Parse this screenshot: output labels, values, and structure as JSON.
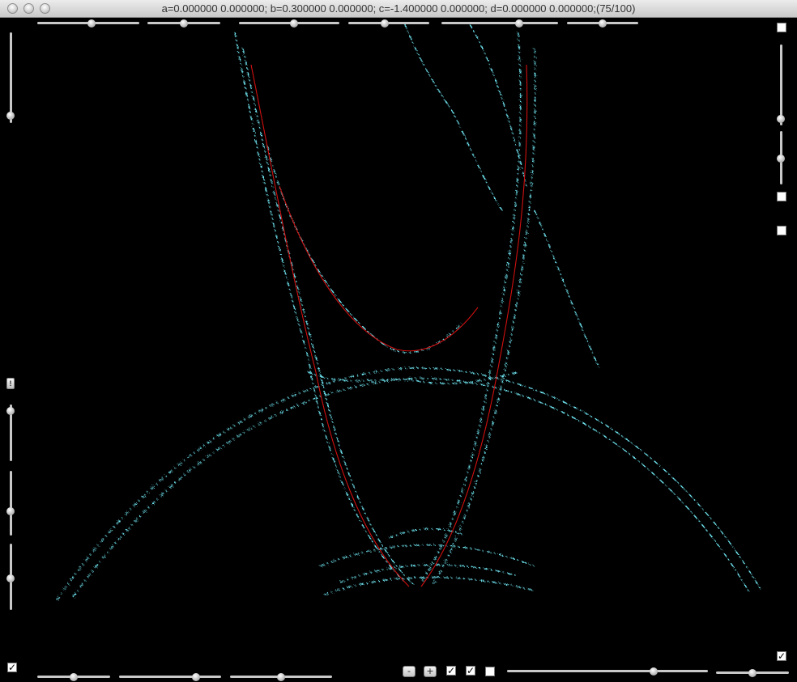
{
  "window": {
    "title": "a=0.000000 0.000000; b=0.300000 0.000000; c=-1.400000 0.000000; d=0.000000 0.000000;(75/100)"
  },
  "controls": {
    "top_sliders": [
      {
        "name": "top-slider-1",
        "value": 0.53
      },
      {
        "name": "top-slider-2",
        "value": 0.5
      },
      {
        "name": "top-slider-3",
        "value": 0.55
      },
      {
        "name": "top-slider-4",
        "value": 0.4
      },
      {
        "name": "top-slider-5",
        "value": 0.67
      },
      {
        "name": "top-slider-6",
        "value": 0.5
      }
    ],
    "left_sliders": [
      {
        "name": "left-slider-1",
        "value": 0.82
      },
      {
        "name": "left-slider-2",
        "value": 0.08
      },
      {
        "name": "left-slider-3",
        "value": 0.65
      },
      {
        "name": "left-slider-4",
        "value": 0.5
      }
    ],
    "right_sliders": [
      {
        "name": "right-slider-1",
        "value": 0.92
      },
      {
        "name": "right-slider-2",
        "value": 0.5
      }
    ],
    "bottom_left_sliders": [
      {
        "name": "bottom-slider-1",
        "value": 0.5
      },
      {
        "name": "bottom-slider-2",
        "value": 0.74
      },
      {
        "name": "bottom-slider-3",
        "value": 0.5
      }
    ],
    "bottom_right_sliders": [
      {
        "name": "bottom-slider-4",
        "value": 0.73
      },
      {
        "name": "bottom-slider-5",
        "value": 0.5
      }
    ],
    "buttons": {
      "minus": "-",
      "plus": "+",
      "warning": "!"
    },
    "checkboxes": {
      "right_top": false,
      "right_mid": false,
      "right_mid2": false,
      "right_bottom": true,
      "left_bottom": true,
      "bottom_1": true,
      "bottom_2": true,
      "bottom_3": false
    }
  },
  "colors": {
    "curve_cyan": "#6fe6f2",
    "curve_red": "#d01010",
    "background": "#000000"
  }
}
